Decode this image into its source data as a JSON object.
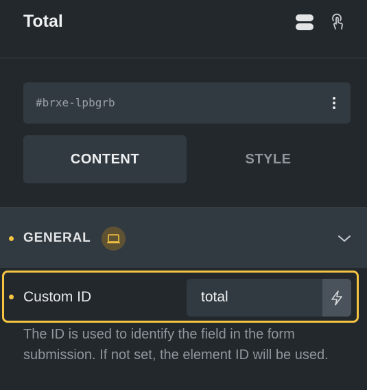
{
  "header": {
    "title": "Total",
    "icons": [
      "layers-icon",
      "pointer-icon"
    ]
  },
  "element_id": {
    "value": "#brxe-lpbgrb"
  },
  "tabs": [
    {
      "label": "CONTENT",
      "active": true
    },
    {
      "label": "STYLE",
      "active": false
    }
  ],
  "section": {
    "title": "GENERAL",
    "accent": "#f5c542"
  },
  "field": {
    "label": "Custom ID",
    "value": "total",
    "help": "The ID is used to identify the field in the form submission. If not set, the element ID will be used."
  }
}
